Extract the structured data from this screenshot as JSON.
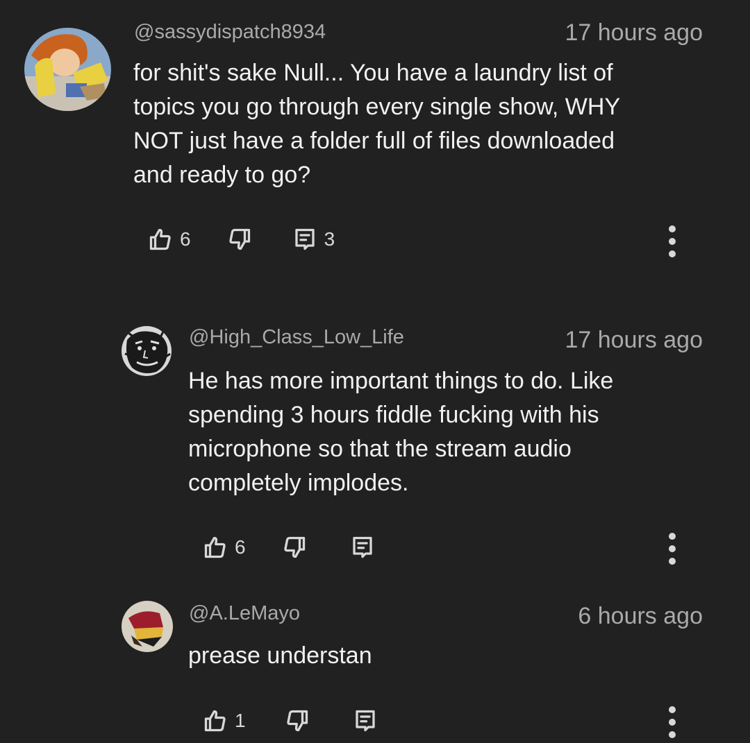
{
  "comments": [
    {
      "handle": "@sassydispatch8934",
      "time": "17 hours ago",
      "text_lines": [
        "for shit's sake Null... You have a laundry list of",
        "topics you go through every single show, WHY",
        "NOT just have a folder full of files downloaded",
        "and ready to go?"
      ],
      "likes": "6",
      "replies": "3",
      "avatar_icon": "anime-character-avatar"
    },
    {
      "handle": "@High_Class_Low_Life",
      "time": "17 hours ago",
      "text_lines": [
        "He has more important things to do. Like",
        "spending 3 hours fiddle fucking with his",
        "microphone so that the stream audio",
        "completely implodes."
      ],
      "likes": "6",
      "avatar_icon": "face-sketch-avatar"
    },
    {
      "handle": "@A.LeMayo",
      "time": "6 hours ago",
      "text_lines": [
        "prease understan"
      ],
      "likes": "1",
      "avatar_icon": "abstract-shape-avatar"
    }
  ],
  "icons": {
    "like": "thumbs-up-icon",
    "dislike": "thumbs-down-icon",
    "reply": "reply-comment-icon",
    "more": "more-vertical-icon"
  },
  "colors": {
    "background": "#212121",
    "text": "#f1f1f1",
    "secondary_text": "#aaaaaa"
  }
}
